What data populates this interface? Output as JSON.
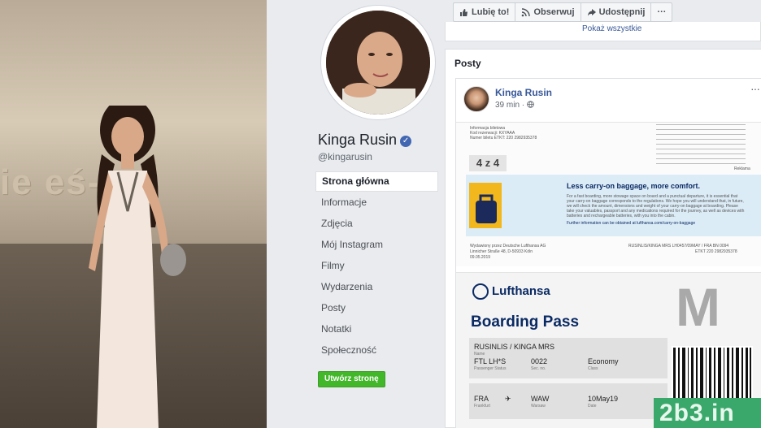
{
  "photo": {
    "wall_text": "ie  eś-s"
  },
  "profile": {
    "name": "Kinga Rusin",
    "handle": "@kingarusin",
    "verified_symbol": "✓"
  },
  "nav": {
    "items": [
      {
        "label": "Strona główna",
        "active": true
      },
      {
        "label": "Informacje"
      },
      {
        "label": "Zdjęcia"
      },
      {
        "label": "Mój Instagram"
      },
      {
        "label": "Filmy"
      },
      {
        "label": "Wydarzenia"
      },
      {
        "label": "Posty"
      },
      {
        "label": "Notatki"
      },
      {
        "label": "Społeczność"
      }
    ],
    "create_page": "Utwórz stronę"
  },
  "actions": {
    "like": "Lubię to!",
    "follow": "Obserwuj",
    "share": "Udostępnij",
    "more": "···"
  },
  "top_card": {
    "show_all": "Pokaż wszystkie"
  },
  "posts": {
    "title": "Posty",
    "post": {
      "author": "Kinga Rusin",
      "time": "39 min",
      "more": "···",
      "doc1": {
        "info_lines": [
          "Informacja biletowa",
          "Kod rezerwacji: KXYAAA",
          "Numer biletu ETKT: 220 2982935378"
        ],
        "counter": "4 z 4",
        "carry_title": "Less carry-on baggage, more comfort.",
        "carry_body": "For a fast boarding, more stowage space on board and a punctual departure, it is essential that your carry-on baggage corresponds to the regulations. We hope you will understand that, in future, we will check the amount, dimensions and weight of your carry-on baggage at boarding. Please take your valuables, passport and any medications required for the journey, as well as devices with batteries and rechargeable batteries, with you into the cabin.",
        "carry_link": "Further information can be obtained at lufthansa.com/carry-on-baggage",
        "footer_left": [
          "Wydawiony przez Deutsche Lufthansa AG",
          "Linnicher Straße 48, D-50933 Köln",
          "09.05.2019"
        ],
        "footer_right": [
          "RUSINLIS/KINGA MRS LH0457/09MAY / FRA BN 0094",
          "ETKT 220 2982935378"
        ],
        "reklama": "Reklama"
      },
      "doc2": {
        "airline": "Lufthansa",
        "zone": "M",
        "title": "Boarding Pass",
        "passenger": "RUSINLIS / KINGA MRS",
        "passenger_label": "Name",
        "status": "FTL LH*S",
        "status_label": "Passenger Status",
        "seq": "0022",
        "seq_label": "Sec. no.",
        "class": "Economy",
        "class_label": "Class",
        "from": "FRA",
        "from_city": "Frankfurt",
        "arrow": "✈",
        "to": "WAW",
        "to_city": "Warsaw",
        "date": "10May19",
        "date_label": "Date"
      }
    }
  },
  "watermark": "2b3.in"
}
